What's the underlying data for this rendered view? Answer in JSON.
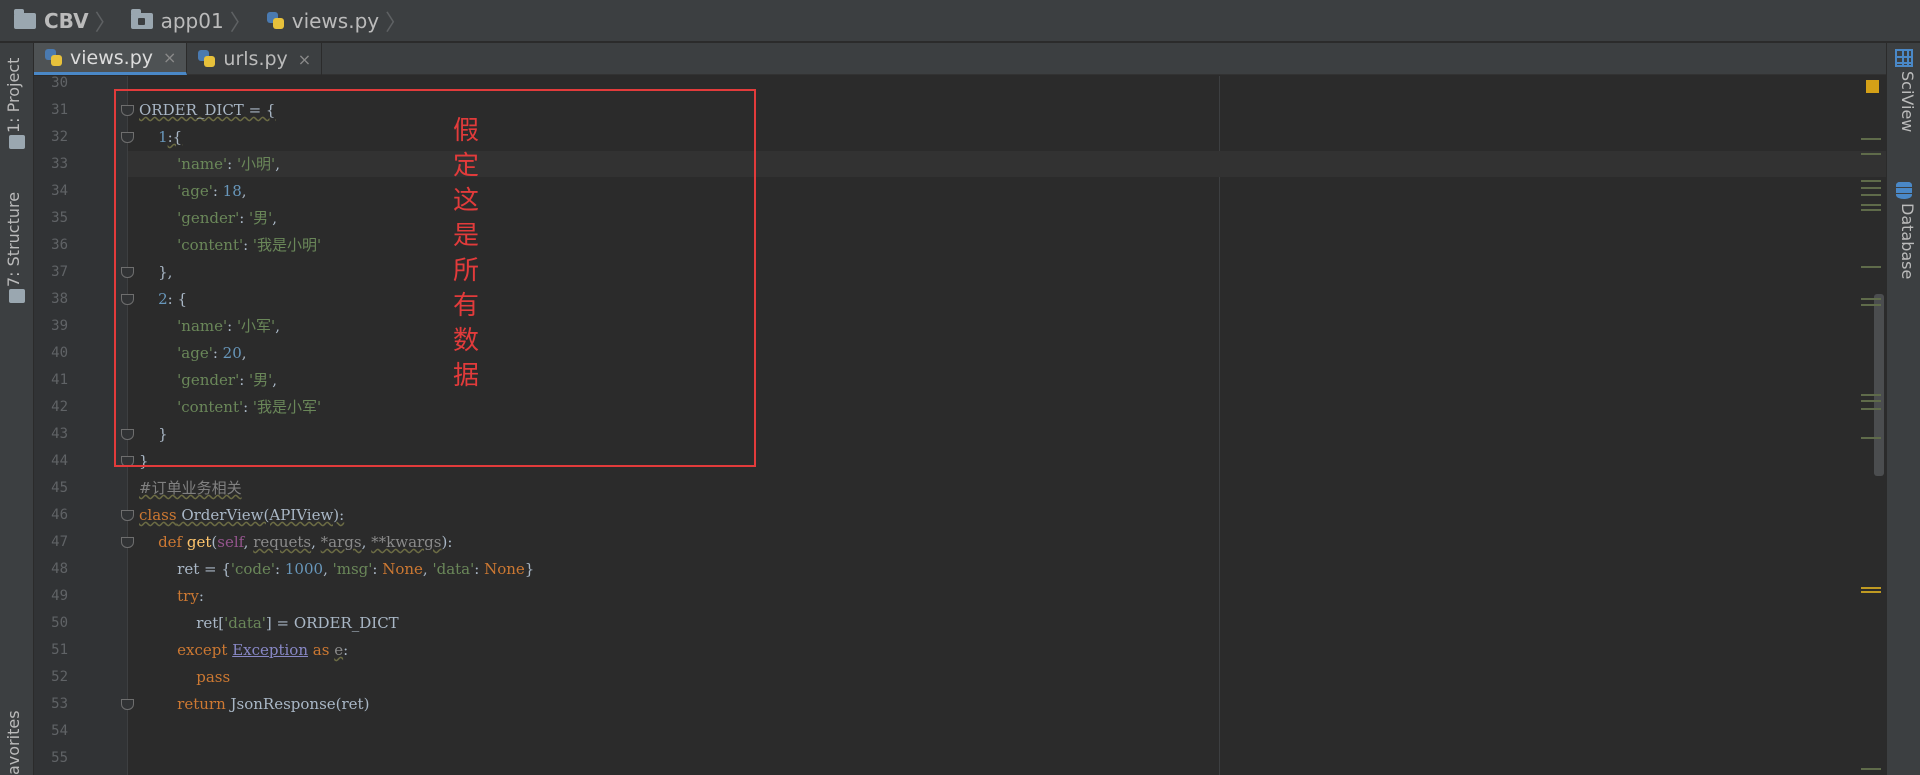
{
  "breadcrumb": [
    {
      "label": "CBV",
      "icon": "folder-icon"
    },
    {
      "label": "app01",
      "icon": "package-folder-icon"
    },
    {
      "label": "views.py",
      "icon": "python-file-icon"
    }
  ],
  "tabs": [
    {
      "label": "views.py",
      "active": true
    },
    {
      "label": "urls.py",
      "active": false
    }
  ],
  "tab_close_glyph": "×",
  "left_tools": [
    "1: Project",
    "7: Structure",
    "avorites"
  ],
  "right_tools": [
    "SciView",
    "Database"
  ],
  "annotation": {
    "text": "假定这是所有数据",
    "color": "#e23b3b"
  },
  "editor": {
    "lines": [
      {
        "n": "30",
        "html": ""
      },
      {
        "n": "31",
        "html": "<span class=\"warn\">ORDER_DICT = {</span>"
      },
      {
        "n": "32",
        "html": "    <span class=\"num\">1</span><span class=\"warn\">:{</span>"
      },
      {
        "n": "33",
        "html": "        <span class=\"str\">'name'</span>: <span class=\"str\">'小明'</span>,"
      },
      {
        "n": "34",
        "html": "        <span class=\"str\">'age'</span>: <span class=\"num\">18</span>,"
      },
      {
        "n": "35",
        "html": "        <span class=\"str\">'gender'</span>: <span class=\"str\">'男'</span>,"
      },
      {
        "n": "36",
        "html": "        <span class=\"str\">'content'</span>: <span class=\"str\">'我是小明'</span>"
      },
      {
        "n": "37",
        "html": "    },"
      },
      {
        "n": "38",
        "html": "    <span class=\"num\">2</span>: {"
      },
      {
        "n": "39",
        "html": "        <span class=\"str\">'name'</span>: <span class=\"str\">'小军'</span>,"
      },
      {
        "n": "40",
        "html": "        <span class=\"str\">'age'</span>: <span class=\"num\">20</span>,"
      },
      {
        "n": "41",
        "html": "        <span class=\"str\">'gender'</span>: <span class=\"str\">'男'</span>,"
      },
      {
        "n": "42",
        "html": "        <span class=\"str\">'content'</span>: <span class=\"str\">'我是小军'</span>"
      },
      {
        "n": "43",
        "html": "    }"
      },
      {
        "n": "44",
        "html": "}"
      },
      {
        "n": "45",
        "html": "<span class=\"cmt\">#订单业务相关</span>"
      },
      {
        "n": "46",
        "html": "<span class=\"kw warn\">class</span><span class=\"warn\"> OrderView(APIView):</span>"
      },
      {
        "n": "47",
        "html": "    <span class=\"kw\">def</span> <span class=\"fn\">get</span>(<span class=\"self\">self</span>, <span class=\"param\">requets</span>, <span class=\"param\">*args</span>, <span class=\"param\">**kwargs</span>):"
      },
      {
        "n": "48",
        "html": "        ret = {<span class=\"str\">'code'</span>: <span class=\"num\">1000</span>, <span class=\"str\">'msg'</span>: <span class=\"kw\">None</span>, <span class=\"str\">'data'</span>: <span class=\"kw\">None</span>}"
      },
      {
        "n": "49",
        "html": "        <span class=\"kw\">try</span>:"
      },
      {
        "n": "50",
        "html": "            ret[<span class=\"str\">'data'</span>] = ORDER_DICT"
      },
      {
        "n": "51",
        "html": "        <span class=\"kw\">except</span> <span class=\"cls\">Exception</span> <span class=\"kw\">as</span> <span class=\"param\">e</span>:"
      },
      {
        "n": "52",
        "html": "            <span class=\"kw\">pass</span>"
      },
      {
        "n": "53",
        "html": "        <span class=\"kw\">return</span> JsonResponse(ret)"
      },
      {
        "n": "54",
        "html": ""
      },
      {
        "n": "55",
        "html": ""
      }
    ],
    "fold_lines": [
      "31",
      "32",
      "37",
      "38",
      "43",
      "44",
      "46",
      "47",
      "53"
    ],
    "caret_line": "33"
  },
  "colors": {
    "keyword": "#cc7832",
    "string": "#6a8759",
    "number": "#6897bb",
    "function": "#ffc66d",
    "self": "#94558d",
    "background": "#2b2b2b"
  }
}
